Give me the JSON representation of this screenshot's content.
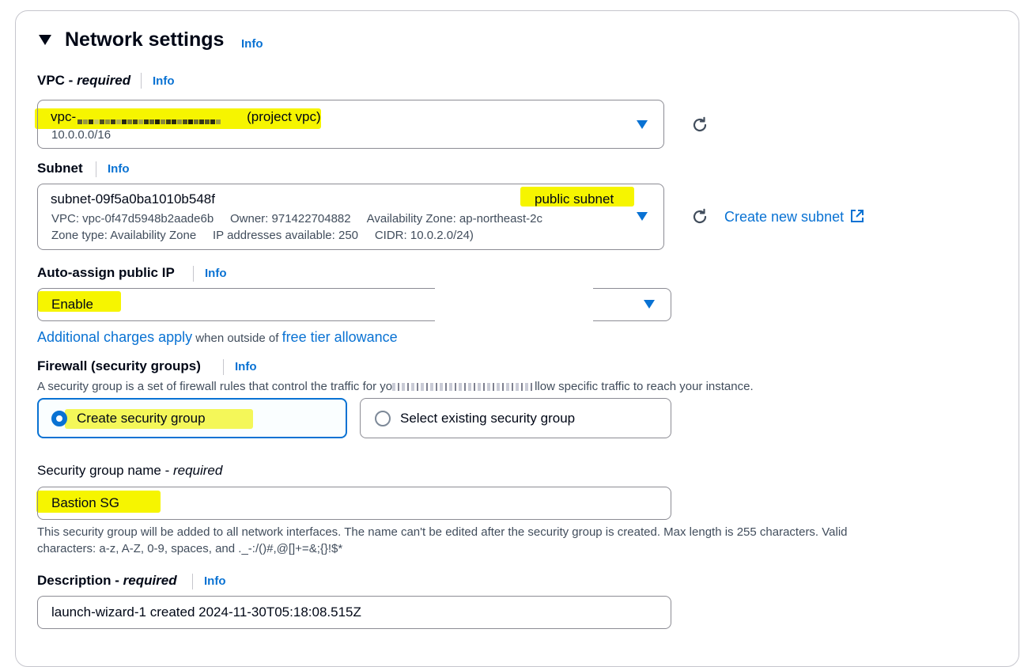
{
  "section": {
    "title": "Network settings",
    "info": "Info"
  },
  "vpc": {
    "label_main": "VPC - ",
    "label_req": "required",
    "info": "Info",
    "value_prefix": "vpc-",
    "value_suffix": "(project vpc)",
    "cidr": "10.0.0.0/16"
  },
  "subnet": {
    "label": "Subnet",
    "info": "Info",
    "value": "subnet-09f5a0ba1010b548f",
    "tag": "public subnet",
    "line1": "VPC: vpc-0f47d5948b2aade6b     Owner: 971422704882     Availability Zone: ap-northeast-2c",
    "line2": "Zone type: Availability Zone     IP addresses available: 250     CIDR: 10.0.2.0/24)",
    "create_link": "Create new subnet"
  },
  "auto_ip": {
    "label": "Auto-assign public IP",
    "info": "Info",
    "value": "Enable",
    "charges_link": "Additional charges apply",
    "charges_mid": " when outside of ",
    "free_tier_link": "free tier allowance"
  },
  "firewall": {
    "label": "Firewall (security groups)",
    "info": "Info",
    "desc_start": "A security group is a set of firewall rules that control the traffic for yo",
    "desc_end": "llow specific traffic to reach your instance.",
    "option_create": "Create security group",
    "option_select": "Select existing security group"
  },
  "sg_name": {
    "label_main": "Security group name - ",
    "label_req": "required",
    "value": "Bastion SG",
    "help1": "This security group will be added to all network interfaces. The name can't be edited after the security group is created. Max length is 255 characters. Valid",
    "help2": "characters: a-z, A-Z, 0-9, spaces, and ._-:/()#,@[]+=&;{}!$*"
  },
  "description": {
    "label_main": "Description - ",
    "label_req": "required",
    "info": "Info",
    "value": "launch-wizard-1 created 2024-11-30T05:18:08.515Z"
  },
  "colors": {
    "link": "#0972d3",
    "highlight": "#f6f500",
    "border": "#8c8c94",
    "selected_bg": "#f0fbff"
  }
}
